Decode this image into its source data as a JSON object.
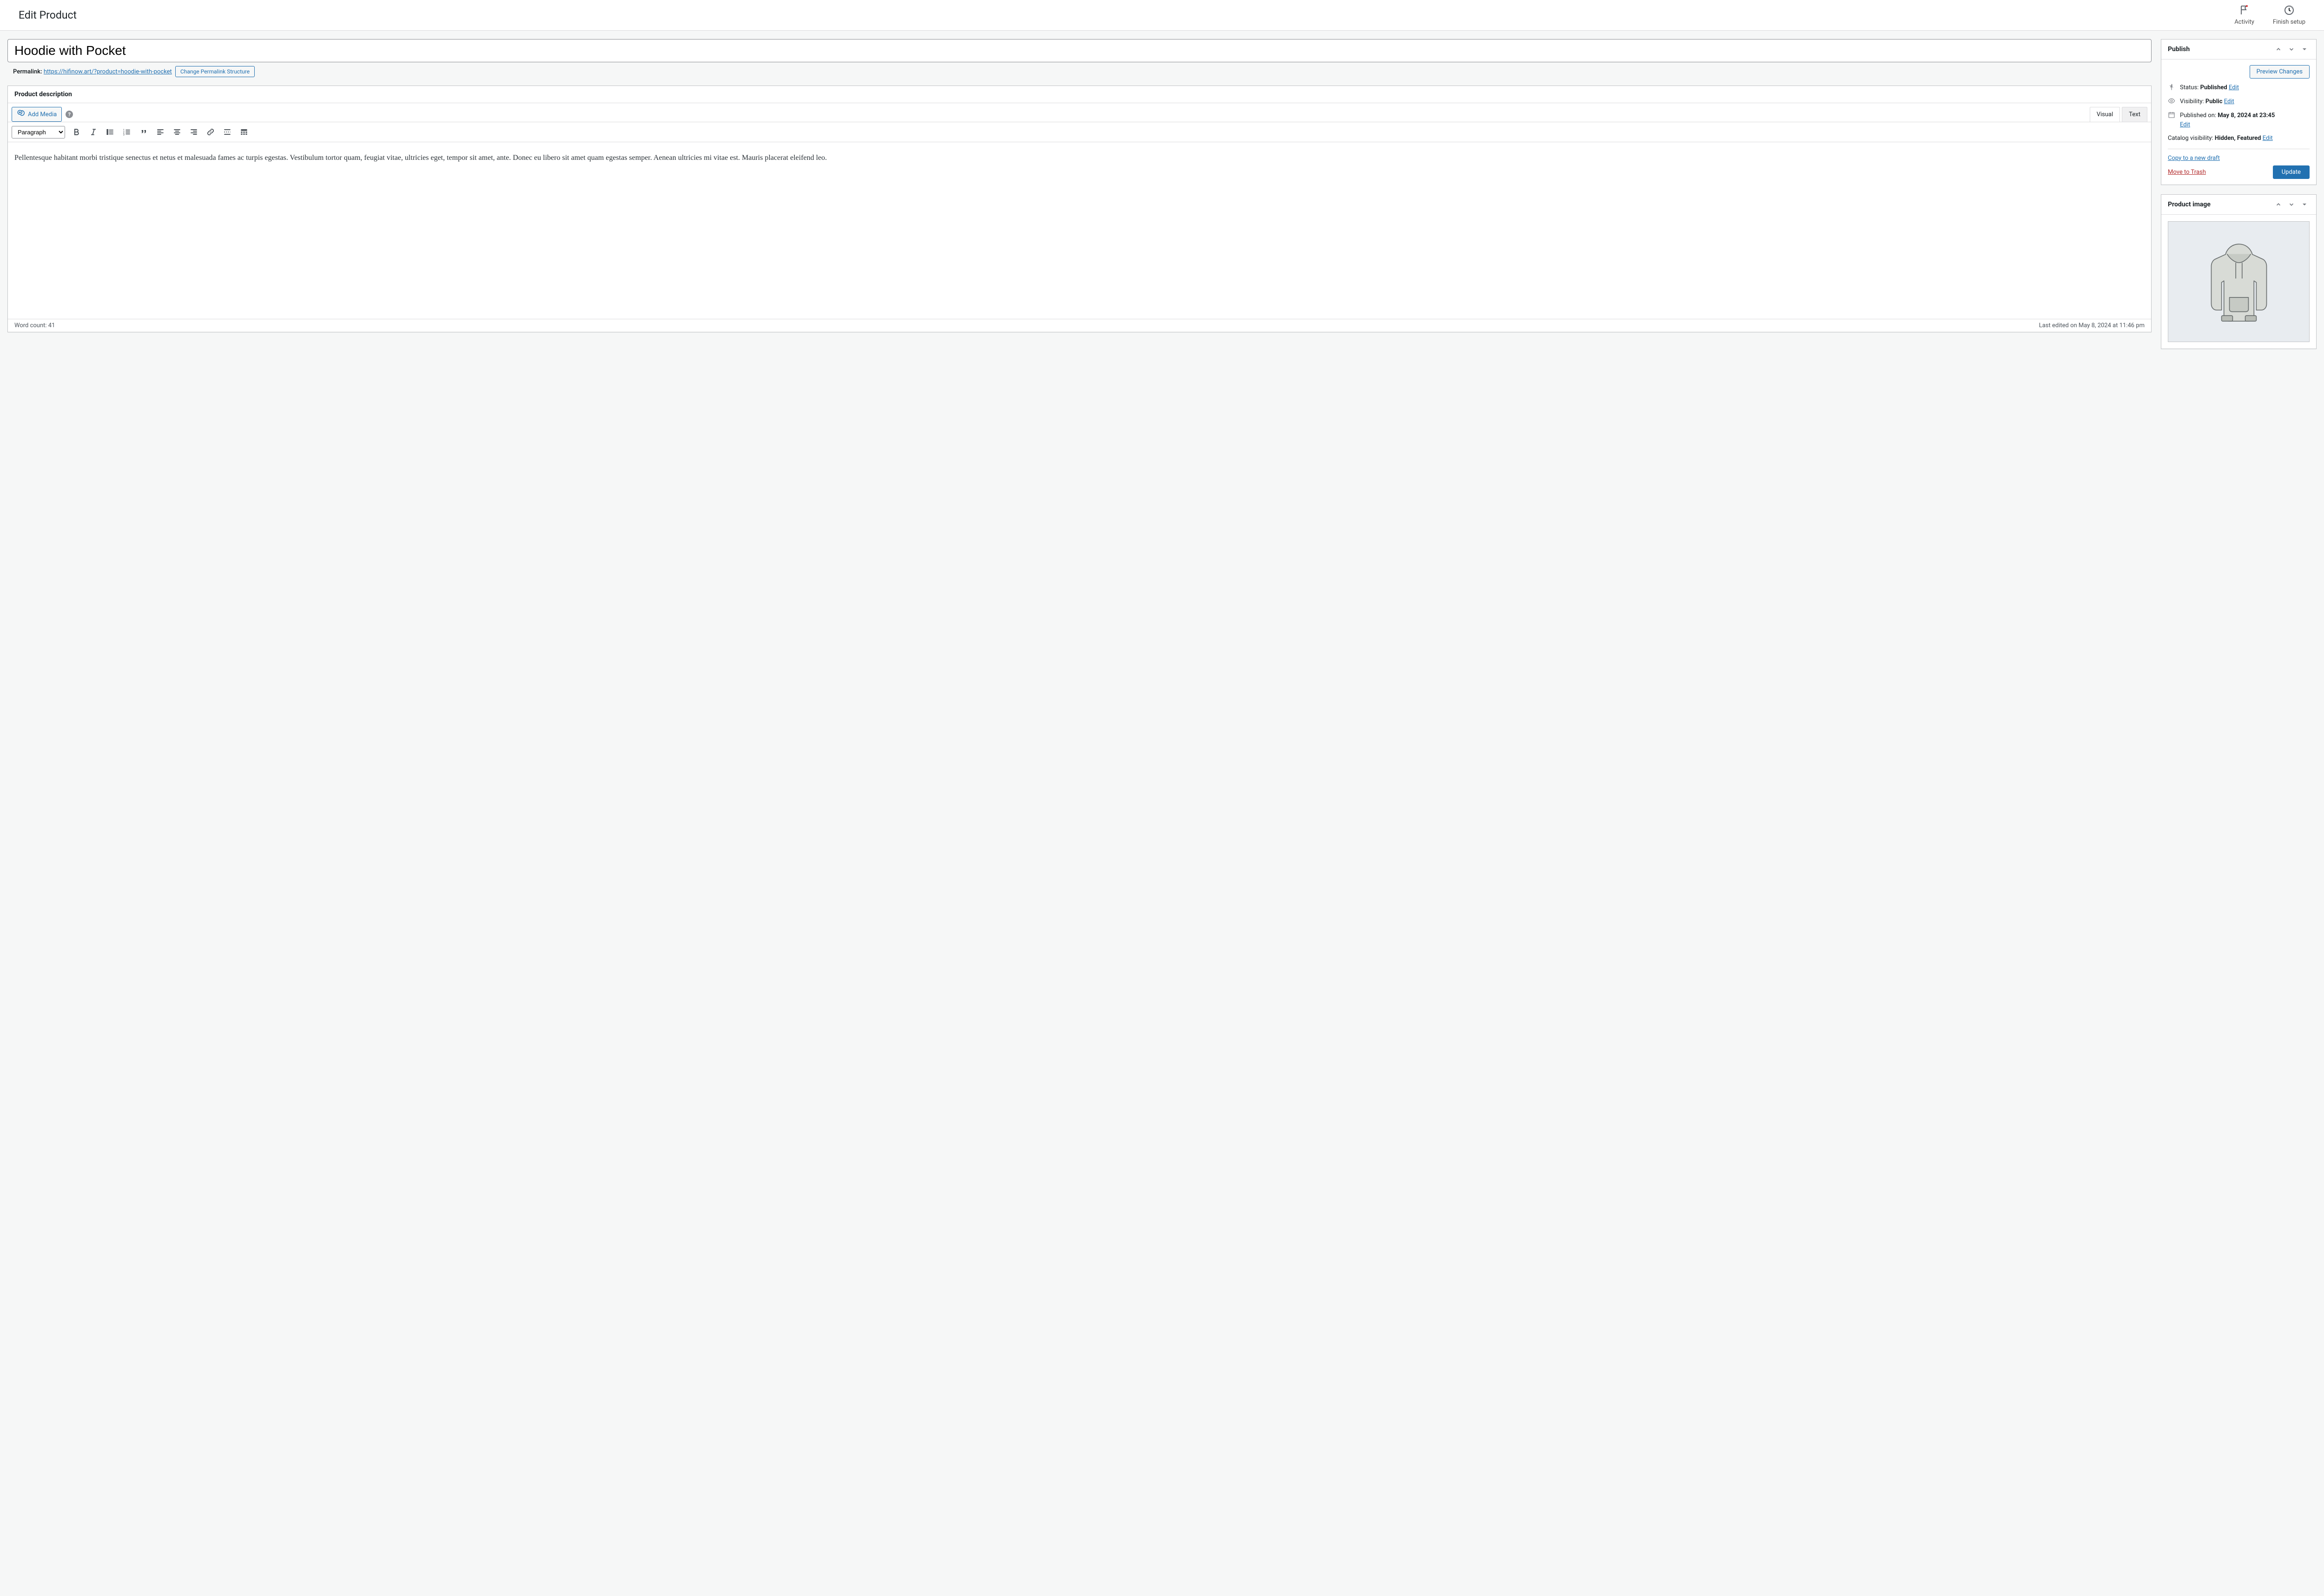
{
  "header": {
    "page_title": "Edit Product",
    "activity_label": "Activity",
    "finish_setup_label": "Finish setup"
  },
  "title_field": {
    "value": "Hoodie with Pocket"
  },
  "permalink": {
    "label": "Permalink:",
    "url": "https://hifinow.art/?product=hoodie-with-pocket",
    "button": "Change Permalink Structure"
  },
  "description": {
    "panel_title": "Product description",
    "add_media": "Add Media",
    "tabs": {
      "visual": "Visual",
      "text": "Text"
    },
    "paragraph_select": "Paragraph",
    "content": "Pellentesque habitant morbi tristique senectus et netus et malesuada fames ac turpis egestas. Vestibulum tortor quam, feugiat vitae, ultricies eget, tempor sit amet, ante. Donec eu libero sit amet quam egestas semper. Aenean ultricies mi vitae est. Mauris placerat eleifend leo.",
    "word_count_label": "Word count:",
    "word_count": "41",
    "last_edited": "Last edited on May 8, 2024 at 11:46 pm"
  },
  "publish": {
    "panel_title": "Publish",
    "preview_btn": "Preview Changes",
    "status_label": "Status:",
    "status_value": "Published",
    "visibility_label": "Visibility:",
    "visibility_value": "Public",
    "published_on_label": "Published on:",
    "published_on_value": "May 8, 2024 at 23:45",
    "catalog_label": "Catalog visibility:",
    "catalog_value": "Hidden, Featured",
    "edit_link": "Edit",
    "draft_link": "Copy to a new draft",
    "trash_link": "Move to Trash",
    "update_btn": "Update"
  },
  "product_image": {
    "panel_title": "Product image",
    "alt": "hoodie illustration"
  }
}
